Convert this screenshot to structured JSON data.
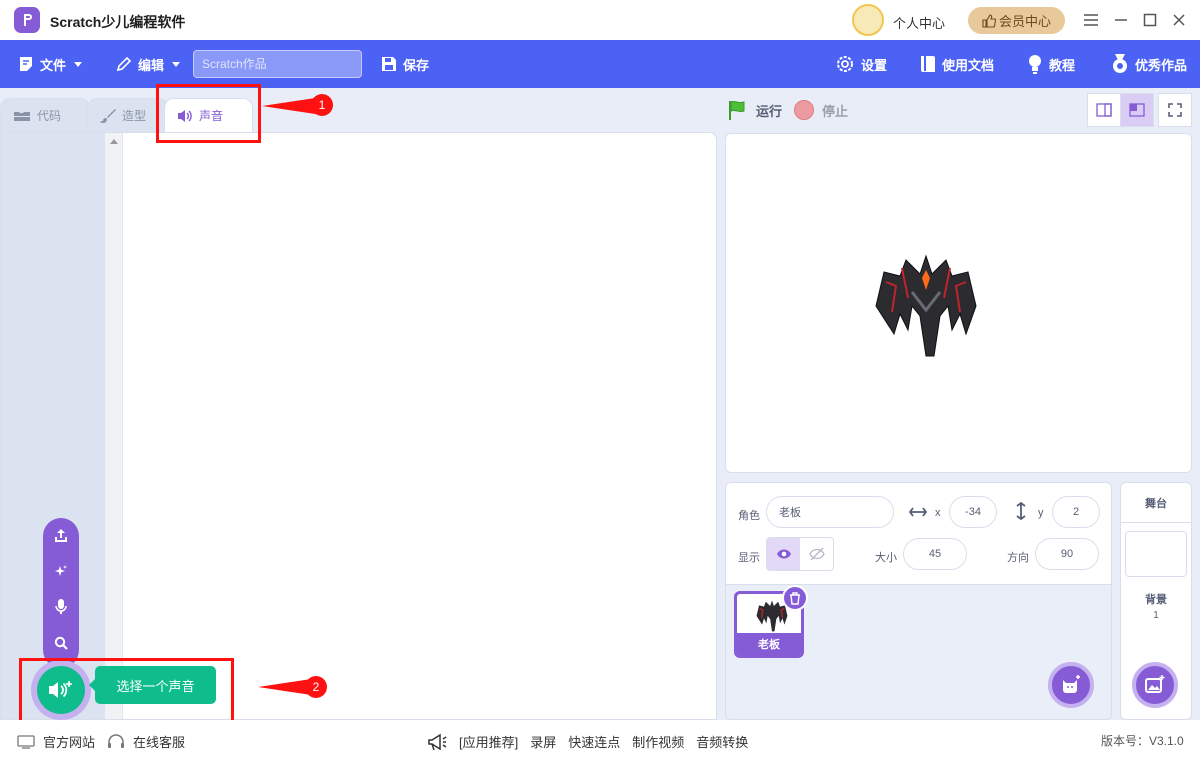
{
  "titlebar": {
    "app_title": "Scratch少儿编程软件",
    "user_center": "个人中心",
    "vip_center": "会员中心"
  },
  "menubar": {
    "file": "文件",
    "edit": "编辑",
    "project_placeholder": "Scratch作品",
    "save": "保存",
    "settings": "设置",
    "docs": "使用文档",
    "tutorials": "教程",
    "showcase": "优秀作品"
  },
  "tabs": {
    "code": "代码",
    "costumes": "造型",
    "sounds": "声音"
  },
  "sound_menu": {
    "tooltip": "选择一个声音"
  },
  "annotations": {
    "marker_1": "1",
    "marker_2": "2"
  },
  "stage": {
    "run": "运行",
    "stop": "停止"
  },
  "sprite_info": {
    "sprite_label": "角色",
    "sprite_name": "老板",
    "x_label": "x",
    "x_value": "-34",
    "y_label": "y",
    "y_value": "2",
    "show_label": "显示",
    "size_label": "大小",
    "size_value": "45",
    "direction_label": "方向",
    "direction_value": "90"
  },
  "sprites": [
    {
      "name": "老板"
    }
  ],
  "backdrop": {
    "title": "舞台",
    "label": "背景",
    "count": "1"
  },
  "statusbar": {
    "official_site": "官方网站",
    "online_service": "在线客服",
    "recommend": "[应用推荐]",
    "links": [
      "录屏",
      "快速连点",
      "制作视频",
      "音频转换"
    ],
    "version": "版本号：V3.1.0"
  },
  "colors": {
    "menubar": "#4c62f5",
    "accent": "#855cd6",
    "sound_green": "#0fbd8c",
    "annotation_red": "#ff1111"
  }
}
